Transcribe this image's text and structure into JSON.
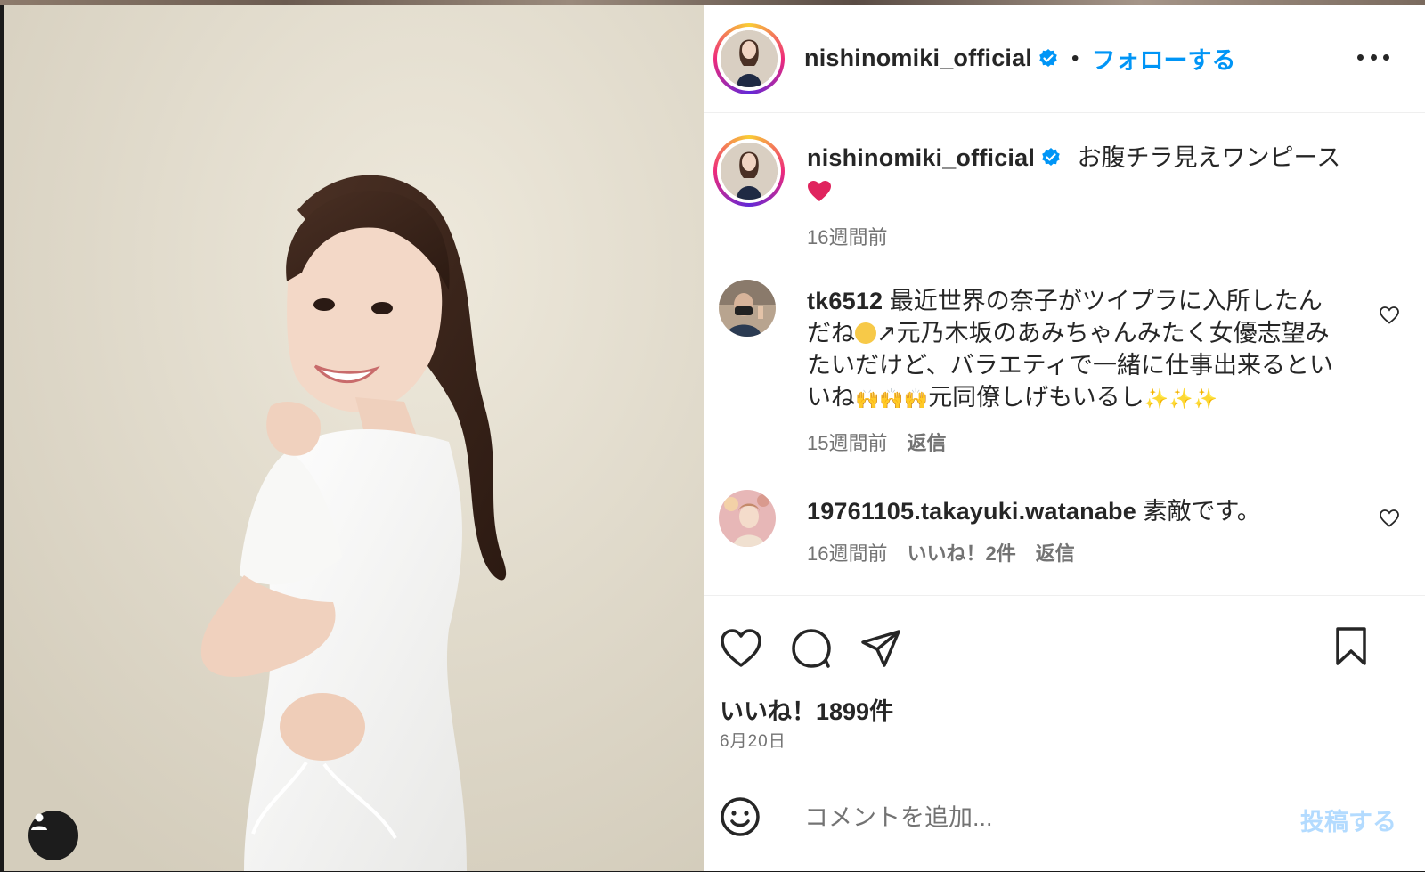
{
  "post": {
    "author": "nishinomiki_official",
    "follow_label": "フォローする",
    "separator": "•",
    "caption_text": "お腹チラ見えワンピース",
    "caption_emoji_icon": "red-heart-icon",
    "caption_time": "16週間前"
  },
  "comments": [
    {
      "username": "tk6512",
      "text_part1": "最近世界の奈子がツイプラに入所したんだね",
      "text_part2": "↗元乃木坂のあみちゃんみたく女優志望みたいだけど、バラエティで一緒に仕事出来るといいね",
      "text_part3": "元同僚しげもいるし",
      "emoji_hands": "🙌🙌🙌",
      "emoji_sparkles": "✨✨✨",
      "time": "15週間前",
      "reply_label": "返信"
    },
    {
      "username": "19761105.takayuki.watanabe",
      "text": "素敵です。",
      "time": "16週間前",
      "likes_label": "いいね！2件",
      "reply_label": "返信"
    }
  ],
  "stats": {
    "likes_label": "いいね！1899件",
    "date": "6月20日"
  },
  "composer": {
    "placeholder": "コメントを追加...",
    "post_label": "投稿する"
  },
  "colors": {
    "accent": "#0095f6",
    "post_disabled": "#b3dbff",
    "text": "#262626",
    "secondary": "#737373",
    "verified": "#0095f6"
  }
}
